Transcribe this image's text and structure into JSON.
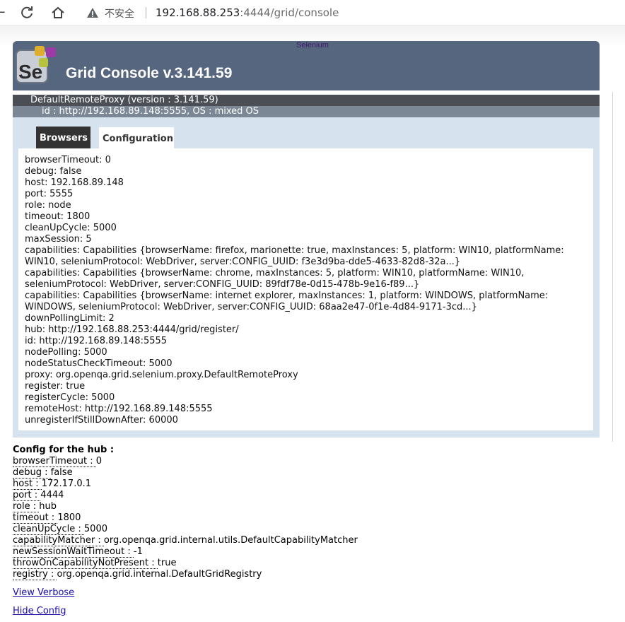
{
  "browser": {
    "insecure_label": "不安全",
    "url_host": "192.168.88.253",
    "url_rest": ":4444/grid/console"
  },
  "header": {
    "logo_text": "Se",
    "selenium_label": "Selenium",
    "title": "Grid Console v.3.141.59"
  },
  "proxy": {
    "name": "DefaultRemoteProxy (version : 3.141.59)",
    "id_line": "id : http://192.168.89.148:5555, OS : mixed OS",
    "tabs": {
      "browsers": "Browsers",
      "configuration": "Configuration"
    },
    "config_lines": [
      "browserTimeout: 0",
      "debug: false",
      "host: 192.168.89.148",
      "port: 5555",
      "role: node",
      "timeout: 1800",
      "cleanUpCycle: 5000",
      "maxSession: 5",
      "capabilities: Capabilities {browserName: firefox, marionette: true, maxInstances: 5, platform: WIN10, platformName: WIN10, seleniumProtocol: WebDriver, server:CONFIG_UUID: f3e3d9ba-dde5-4633-82d8-32a...}",
      "capabilities: Capabilities {browserName: chrome, maxInstances: 5, platform: WIN10, platformName: WIN10, seleniumProtocol: WebDriver, server:CONFIG_UUID: 89fdf78e-0d15-478b-9e16-f89...}",
      "capabilities: Capabilities {browserName: internet explorer, maxInstances: 1, platform: WINDOWS, platformName: WINDOWS, seleniumProtocol: WebDriver, server:CONFIG_UUID: 68aa2e47-0f1e-4d84-9171-3cd...}",
      "downPollingLimit: 2",
      "hub: http://192.168.88.253:4444/grid/register/",
      "id: http://192.168.89.148:5555",
      "nodePolling: 5000",
      "nodeStatusCheckTimeout: 5000",
      "proxy: org.openqa.grid.selenium.proxy.DefaultRemoteProxy",
      "register: true",
      "registerCycle: 5000",
      "remoteHost: http://192.168.89.148:5555",
      "unregisterIfStillDownAfter: 60000"
    ]
  },
  "hub": {
    "title": "Config for the hub :",
    "rows": [
      {
        "key": "browserTimeout : ",
        "value": "0"
      },
      {
        "key": "debug : ",
        "value": "false"
      },
      {
        "key": "host : ",
        "value": "172.17.0.1"
      },
      {
        "key": "port : ",
        "value": "4444"
      },
      {
        "key": "role : ",
        "value": "hub"
      },
      {
        "key": "timeout : ",
        "value": "1800"
      },
      {
        "key": "cleanUpCycle : ",
        "value": "5000"
      },
      {
        "key": "capabilityMatcher : ",
        "value": "org.openqa.grid.internal.utils.DefaultCapabilityMatcher"
      },
      {
        "key": "newSessionWaitTimeout : ",
        "value": "-1"
      },
      {
        "key": "throwOnCapabilityNotPresent : ",
        "value": "true"
      },
      {
        "key": "registry : ",
        "value": "org.openqa.grid.internal.DefaultGridRegistry"
      }
    ],
    "view_verbose": "View Verbose",
    "hide_config": "Hide Config"
  }
}
